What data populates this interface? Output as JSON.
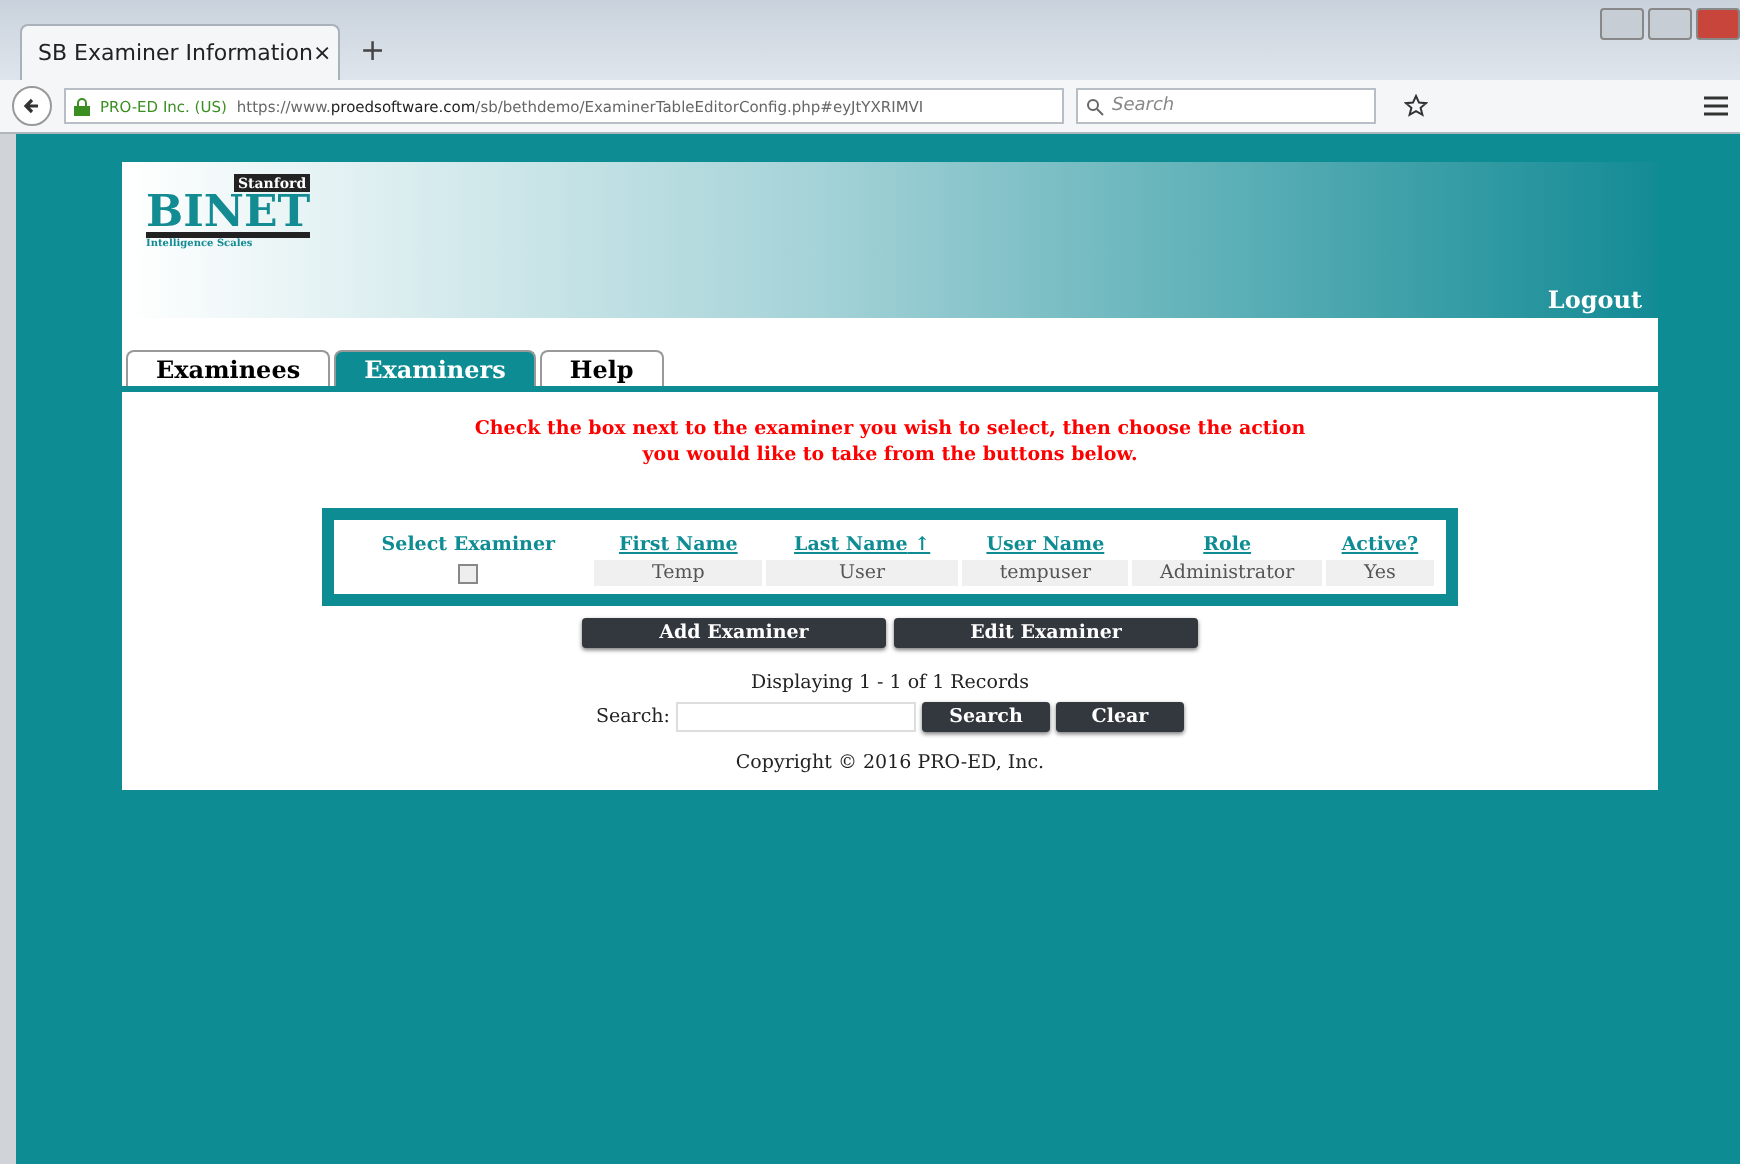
{
  "browser": {
    "tab_title": "SB Examiner Information",
    "tab_close": "×",
    "new_tab": "+",
    "site_identity": "PRO-ED Inc. (US)",
    "url_prefix": "https://www.",
    "url_domain": "proedsoftware.com",
    "url_path": "/sb/bethdemo/ExaminerTableEditorConfig.php#eyJtYXRIMVI",
    "search_placeholder": "Search"
  },
  "logo": {
    "top": "Stanford",
    "main": "BINET",
    "sub": "Intelligence Scales"
  },
  "logout": "Logout",
  "tabs": [
    {
      "label": "Examinees",
      "selected": false
    },
    {
      "label": "Examiners",
      "selected": true
    },
    {
      "label": "Help",
      "selected": false
    }
  ],
  "instructions": [
    "Check the box next to the examiner you wish to select, then choose the action",
    "you would like to take from the buttons below."
  ],
  "table": {
    "columns": [
      {
        "label": "Select Examiner",
        "kind": "plain"
      },
      {
        "label": "First Name",
        "kind": "link"
      },
      {
        "label": "Last Name",
        "kind": "link",
        "sort": "↑"
      },
      {
        "label": "User Name",
        "kind": "link"
      },
      {
        "label": "Role",
        "kind": "link"
      },
      {
        "label": "Active?",
        "kind": "link"
      }
    ],
    "rows": [
      {
        "cells": [
          {
            "kind": "checkbox",
            "checked": false
          },
          {
            "kind": "text",
            "text": "Temp"
          },
          {
            "kind": "text",
            "text": "User"
          },
          {
            "kind": "text",
            "text": "tempuser"
          },
          {
            "kind": "text",
            "text": "Administrator"
          },
          {
            "kind": "text",
            "text": "Yes"
          }
        ]
      }
    ]
  },
  "actions": [
    "Add Examiner",
    "Edit Examiner"
  ],
  "record_count": "Displaying 1 - 1 of 1 Records",
  "search": {
    "label": "Search:",
    "buttons": [
      "Search",
      "Clear"
    ]
  },
  "copyright": {
    "before": "Copyright",
    "symbol": "©",
    "after": "2016 PRO-ED, Inc."
  }
}
